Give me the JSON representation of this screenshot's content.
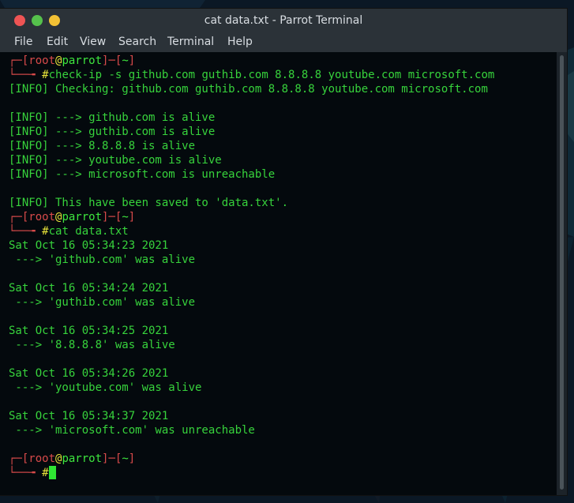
{
  "window": {
    "title": "cat data.txt - Parrot Terminal",
    "colors": {
      "titlebar": "#2b3238",
      "close": "#ee5454",
      "minimize": "#55c14c",
      "maximize": "#f2c135",
      "text": "#37d33c",
      "prompt_bracket": "#d84a4a",
      "hash": "#e6e23a",
      "cursor": "#2fe533"
    }
  },
  "menu": [
    "File",
    "Edit",
    "View",
    "Search",
    "Terminal",
    "Help"
  ],
  "prompts": [
    {
      "corner": "┌─",
      "open": "[",
      "user": "root",
      "at": "@",
      "host": "parrot",
      "close": "]",
      "dash": "─",
      "dir_open": "[",
      "dir": "~",
      "dir_close": "]",
      "branch": "└──╼ ",
      "hash": "#",
      "command": "check-ip -s github.com guthib.com 8.8.8.8 youtube.com microsoft.com"
    },
    {
      "corner": "┌─",
      "open": "[",
      "user": "root",
      "at": "@",
      "host": "parrot",
      "close": "]",
      "dash": "─",
      "dir_open": "[",
      "dir": "~",
      "dir_close": "]",
      "branch": "└──╼ ",
      "hash": "#",
      "command": "cat data.txt"
    },
    {
      "corner": "┌─",
      "open": "[",
      "user": "root",
      "at": "@",
      "host": "parrot",
      "close": "]",
      "dash": "─",
      "dir_open": "[",
      "dir": "~",
      "dir_close": "]",
      "branch": "└──╼ ",
      "hash": "#",
      "command": ""
    }
  ],
  "output1": [
    "[INFO] Checking: github.com guthib.com 8.8.8.8 youtube.com microsoft.com",
    "",
    "[INFO] ---> github.com is alive",
    "[INFO] ---> guthib.com is alive",
    "[INFO] ---> 8.8.8.8 is alive",
    "[INFO] ---> youtube.com is alive",
    "[INFO] ---> microsoft.com is unreachable",
    "",
    "[INFO] This have been saved to 'data.txt'."
  ],
  "output2": [
    "Sat Oct 16 05:34:23 2021",
    " ---> 'github.com' was alive",
    "",
    "Sat Oct 16 05:34:24 2021",
    " ---> 'guthib.com' was alive",
    "",
    "Sat Oct 16 05:34:25 2021",
    " ---> '8.8.8.8' was alive",
    "",
    "Sat Oct 16 05:34:26 2021",
    " ---> 'youtube.com' was alive",
    "",
    "Sat Oct 16 05:34:37 2021",
    " ---> 'microsoft.com' was unreachable"
  ]
}
